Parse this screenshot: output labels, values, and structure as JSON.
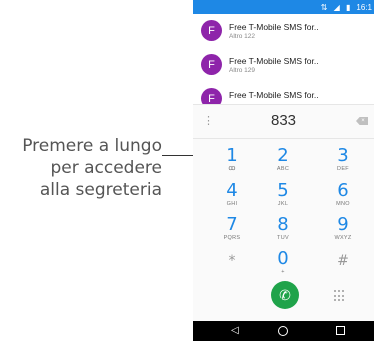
{
  "callout": {
    "lines": [
      "Premere a lungo",
      "per accedere",
      "alla segreteria"
    ]
  },
  "status_bar": {
    "time": "16:1",
    "icons": [
      "data-icon",
      "signal-icon",
      "battery-icon"
    ]
  },
  "sms_list": [
    {
      "avatar": "F",
      "title": "Free T-Mobile SMS for..",
      "subtitle": "Altro 122"
    },
    {
      "avatar": "F",
      "title": "Free T-Mobile SMS for..",
      "subtitle": "Altro 129"
    },
    {
      "avatar": "F",
      "title": "Free T-Mobile SMS for..",
      "subtitle": ""
    }
  ],
  "dialer": {
    "number": "833",
    "keys": [
      {
        "num": "1",
        "letters": "ꝏ"
      },
      {
        "num": "2",
        "letters": "ABC"
      },
      {
        "num": "3",
        "letters": "DEF"
      },
      {
        "num": "4",
        "letters": "GHI"
      },
      {
        "num": "5",
        "letters": "JKL"
      },
      {
        "num": "6",
        "letters": "MNO"
      },
      {
        "num": "7",
        "letters": "PQRS"
      },
      {
        "num": "8",
        "letters": "TUV"
      },
      {
        "num": "9",
        "letters": "WXYZ"
      },
      {
        "num": "*",
        "letters": ""
      },
      {
        "num": "0",
        "letters": "+"
      },
      {
        "num": "#",
        "letters": ""
      }
    ]
  },
  "colors": {
    "accent": "#1e88e5",
    "avatar": "#8e24aa",
    "call_button": "#1fa34a"
  }
}
